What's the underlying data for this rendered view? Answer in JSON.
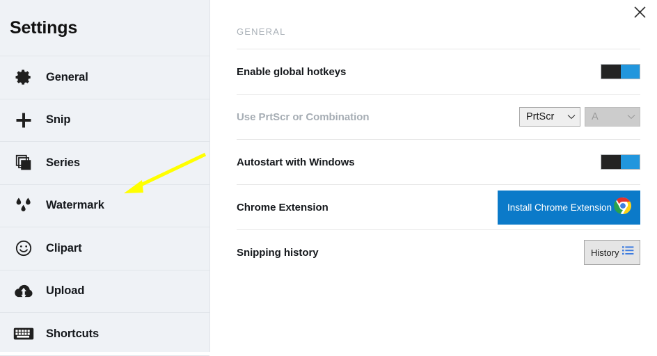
{
  "sidebar": {
    "title": "Settings",
    "items": [
      {
        "label": "General",
        "icon": "gear-icon"
      },
      {
        "label": "Snip",
        "icon": "plus-icon"
      },
      {
        "label": "Series",
        "icon": "stacked-squares-icon"
      },
      {
        "label": "Watermark",
        "icon": "water-drops-icon"
      },
      {
        "label": "Clipart",
        "icon": "smiley-face-icon"
      },
      {
        "label": "Upload",
        "icon": "cloud-upload-icon"
      },
      {
        "label": "Shortcuts",
        "icon": "keyboard-icon"
      }
    ]
  },
  "main": {
    "section_header": "GENERAL",
    "close_label": "×",
    "rows": [
      {
        "label": "Enable global hotkeys",
        "control": "toggle",
        "state": "on"
      },
      {
        "label": "Use PrtScr or Combination",
        "control": "dropdowns",
        "disabled": true,
        "dropdown_primary": "PrtScr",
        "dropdown_secondary": "A"
      },
      {
        "label": "Autostart with Windows",
        "control": "toggle",
        "state": "on"
      },
      {
        "label": "Chrome Extension",
        "control": "chrome-button",
        "button_label": "Install Chrome Extension"
      },
      {
        "label": "Snipping history",
        "control": "history-button",
        "button_label": "History"
      }
    ]
  },
  "annotation": {
    "type": "arrow",
    "color": "#ffff00",
    "points_to": "Watermark"
  },
  "colors": {
    "sidebar_bg": "#eff2f6",
    "accent_blue": "#2196dd",
    "button_blue": "#0b7ac9",
    "toggle_dark": "#232323",
    "text_primary": "#15181c",
    "text_muted": "#a6adb4",
    "section_header": "#a9b0b7",
    "annotation_yellow": "#ffff00"
  }
}
